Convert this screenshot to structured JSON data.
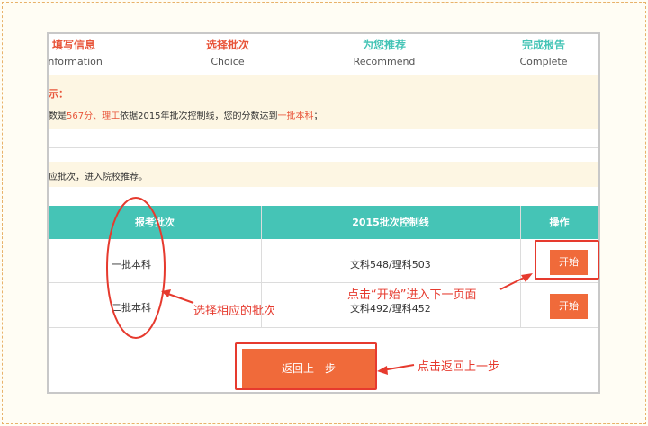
{
  "steps": [
    {
      "title": "填写信息",
      "subtitle": "Information",
      "color": "#e8553a"
    },
    {
      "title": "选择批次",
      "subtitle": "Choice",
      "color": "#e8553a"
    },
    {
      "title": "为您推荐",
      "subtitle": "Recommend",
      "color": "#45c4b6"
    },
    {
      "title": "完成报告",
      "subtitle": "Complete",
      "color": "#45c4b6"
    }
  ],
  "notice": {
    "heading": "示：",
    "prefix": "数是",
    "score": "567分",
    "sep": "、",
    "subject": "理工",
    "mid": "依据2015年批次控制线，您的分数达到",
    "level": "一批本科",
    "end": "；"
  },
  "hint": "应批次，进入院校推荐。",
  "table": {
    "headers": [
      "报考批次",
      "2015批次控制线",
      "操作"
    ],
    "rows": [
      {
        "batch": "一批本科",
        "line": "文科548/理科503",
        "action": "开始"
      },
      {
        "batch": "二批本科",
        "line": "文科492/理科452",
        "action": "开始"
      }
    ]
  },
  "back_button": "返回上一步",
  "annotations": {
    "choose": "选择相应的批次",
    "start": "点击“开始”进入下一页面",
    "back": "点击返回上一步"
  },
  "colors": {
    "accent": "#f06a3a",
    "teal": "#45c4b6",
    "annotation": "#e63a2e"
  }
}
